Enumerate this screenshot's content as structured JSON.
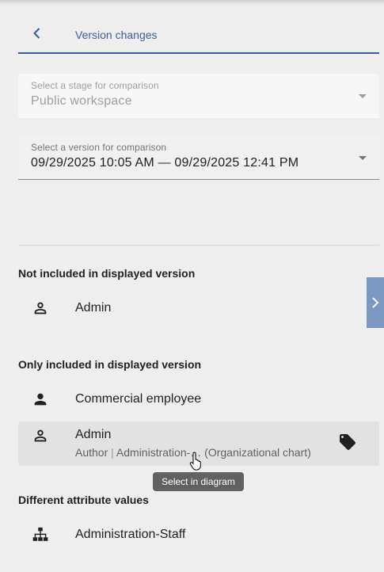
{
  "header": {
    "title": "Version changes"
  },
  "stage_select": {
    "label": "Select a stage for comparison",
    "value": "Public workspace"
  },
  "version_select": {
    "label": "Select a version for comparison",
    "value": "09/29/2025 10:05 AM — 09/29/2025 12:41 PM"
  },
  "sections": [
    {
      "title": "Not included in displayed version",
      "items": [
        {
          "label": "Admin",
          "icon": "person-outline-icon"
        }
      ]
    },
    {
      "title": "Only included in displayed version",
      "items": [
        {
          "label": "Commercial employee",
          "icon": "person-filled-icon"
        },
        {
          "label": "Admin",
          "icon": "person-outline-icon",
          "sub_role": "Author",
          "sub_sep": "|",
          "sub_unit": "Administration-…",
          "sub_model": "(Organizational chart)"
        }
      ]
    },
    {
      "title": "Different attribute values",
      "items": [
        {
          "label": "Administration-Staff",
          "icon": "org-chart-icon"
        }
      ]
    }
  ],
  "tooltip": {
    "text": "Select in diagram"
  },
  "colors": {
    "accent": "#3b5f9a",
    "side_tab": "#7c99c4",
    "background": "#eeeeee"
  }
}
